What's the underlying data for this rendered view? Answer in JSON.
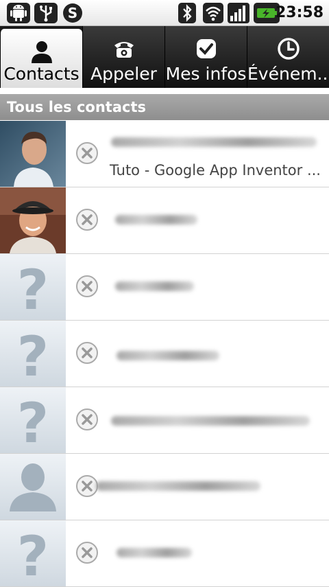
{
  "status_bar": {
    "time": "23:58",
    "left_icons": [
      "android-debug-icon",
      "usb-icon",
      "skype-icon"
    ],
    "right_icons": [
      "bluetooth-icon",
      "wifi-icon",
      "signal-icon",
      "battery-charging-icon"
    ]
  },
  "tabs": [
    {
      "label": "Contacts",
      "icon": "person-icon",
      "active": true
    },
    {
      "label": "Appeler",
      "icon": "phone-icon",
      "active": false
    },
    {
      "label": "Mes infos",
      "icon": "checkmark-icon",
      "active": false
    },
    {
      "label": "Événem...",
      "icon": "clock-icon",
      "active": false
    }
  ],
  "section_title": "Tous les contacts",
  "contacts": [
    {
      "avatar": "photo",
      "status": "offline",
      "subtitle": "Tuto - Google App Inventor ..."
    },
    {
      "avatar": "photo",
      "status": "offline",
      "subtitle": ""
    },
    {
      "avatar": "unknown",
      "status": "offline",
      "subtitle": ""
    },
    {
      "avatar": "unknown",
      "status": "offline",
      "subtitle": ""
    },
    {
      "avatar": "unknown",
      "status": "offline",
      "subtitle": ""
    },
    {
      "avatar": "silhouette",
      "status": "offline",
      "subtitle": ""
    },
    {
      "avatar": "unknown",
      "status": "offline",
      "subtitle": ""
    }
  ],
  "colors": {
    "status_bar_bg": "#e9e9e9",
    "tab_bg": "#111111",
    "active_tab_bg": "#ffffff",
    "section_header_bg": "#9d9d9d",
    "battery_green": "#49b52a"
  }
}
